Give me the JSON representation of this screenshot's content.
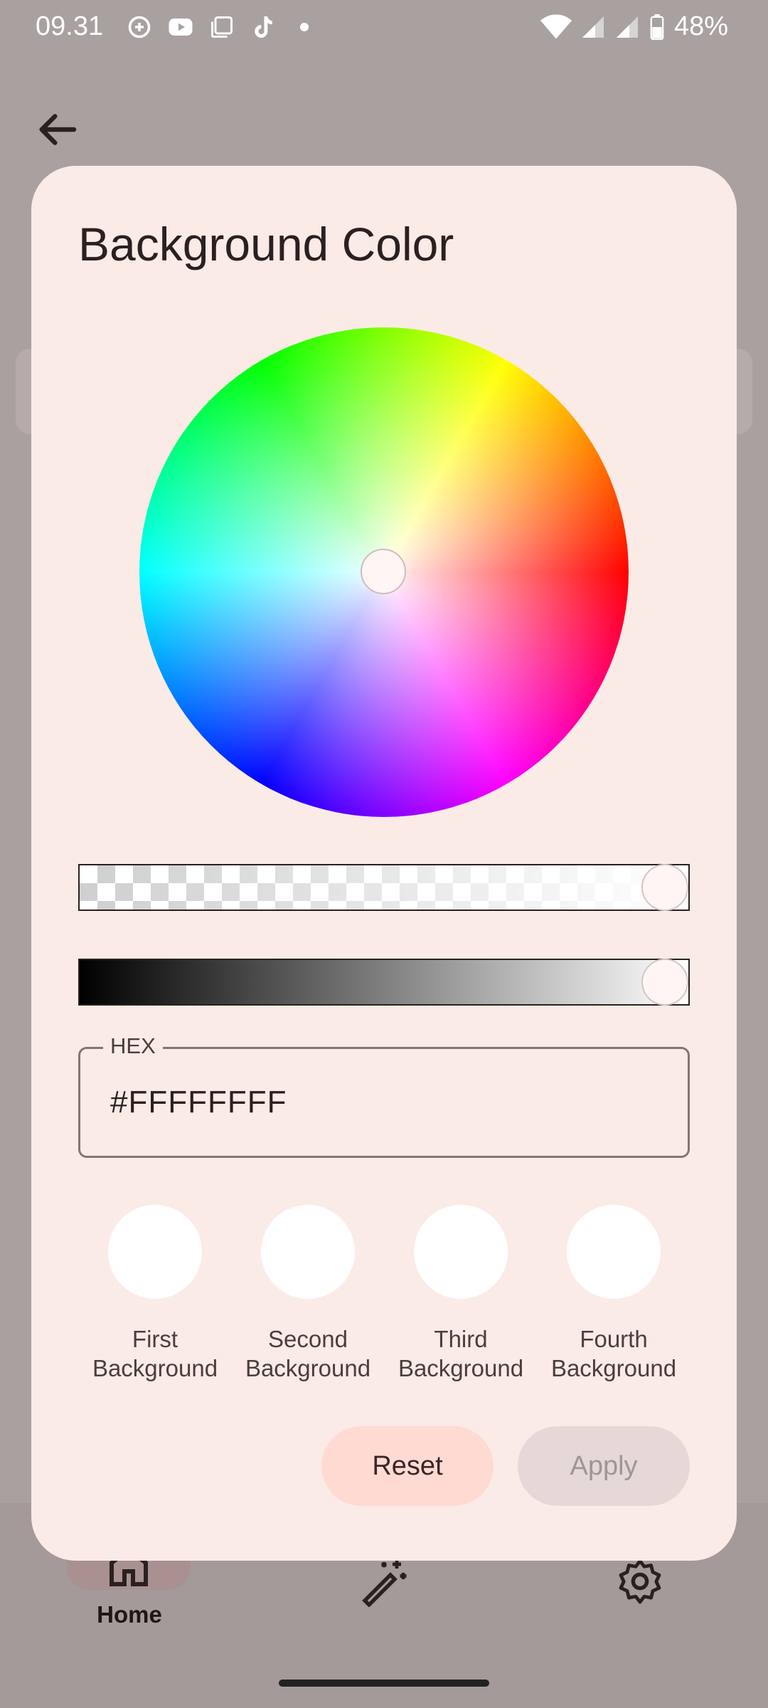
{
  "status_bar": {
    "time": "09.31",
    "battery": "48%",
    "icons": [
      "sync-icon",
      "youtube-icon",
      "screenshot-icon",
      "tiktok-icon",
      "dot-icon",
      "wifi-icon",
      "signal-icon",
      "signal-icon",
      "battery-icon"
    ]
  },
  "nav": {
    "home_label": "Home",
    "items": [
      "home-icon",
      "magic-wand-icon",
      "settings-icon"
    ]
  },
  "dialog": {
    "title": "Background Color",
    "hex_label": "HEX",
    "hex_value": "#FFFFFFFF",
    "alpha_level": 1.0,
    "brightness_level": 1.0,
    "swatches": [
      {
        "label": "First\nBackground",
        "color": "#FFFFFF"
      },
      {
        "label": "Second\nBackground",
        "color": "#FFFFFF"
      },
      {
        "label": "Third\nBackground",
        "color": "#FFFFFF"
      },
      {
        "label": "Fourth\nBackground",
        "color": "#FFFFFF"
      }
    ],
    "reset_label": "Reset",
    "apply_label": "Apply"
  },
  "colors": {
    "dialog_bg": "#FBEBE6",
    "scrim": "#A9A1A0",
    "reset_bg": "#FFDAD3",
    "apply_bg_disabled": "#E5D8D6"
  }
}
